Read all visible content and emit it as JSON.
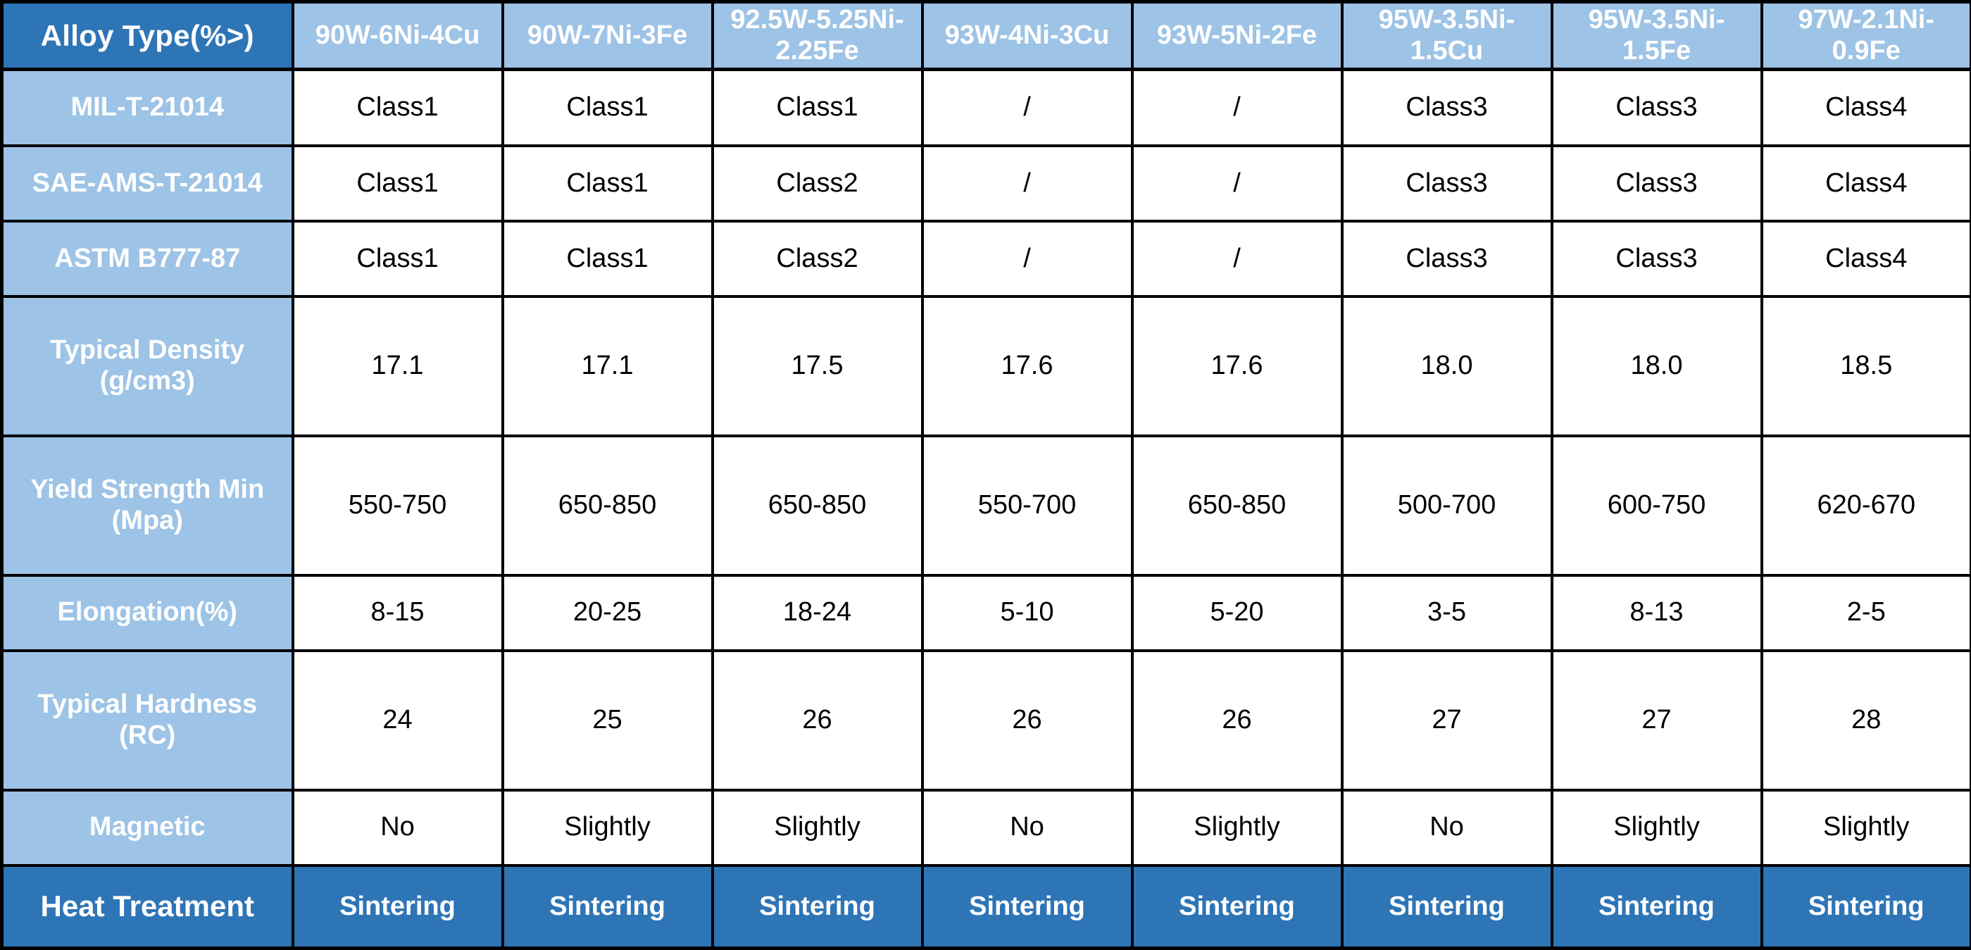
{
  "table": {
    "corner_header": "Alloy Type(%>)",
    "columns": [
      "90W-6Ni-4Cu",
      "90W-7Ni-3Fe",
      "92.5W-5.25Ni-2.25Fe",
      "93W-4Ni-3Cu",
      "93W-5Ni-2Fe",
      "95W-3.5Ni-1.5Cu",
      "95W-3.5Ni-1.5Fe",
      "97W-2.1Ni-0.9Fe"
    ],
    "rows": [
      {
        "label": "MIL-T-21014",
        "style": "normal",
        "values": [
          "Class1",
          "Class1",
          "Class1",
          "/",
          "/",
          "Class3",
          "Class3",
          "Class4"
        ]
      },
      {
        "label": "SAE-AMS-T-21014",
        "style": "normal",
        "values": [
          "Class1",
          "Class1",
          "Class2",
          "/",
          "/",
          "Class3",
          "Class3",
          "Class4"
        ]
      },
      {
        "label": "ASTM B777-87",
        "style": "normal",
        "values": [
          "Class1",
          "Class1",
          "Class2",
          "/",
          "/",
          "Class3",
          "Class3",
          "Class4"
        ]
      },
      {
        "label": "Typical Density (g/cm3)",
        "style": "normal",
        "values": [
          "17.1",
          "17.1",
          "17.5",
          "17.6",
          "17.6",
          "18.0",
          "18.0",
          "18.5"
        ]
      },
      {
        "label": "Yield Strength Min (Mpa)",
        "style": "normal",
        "values": [
          "550-750",
          "650-850",
          "650-850",
          "550-700",
          "650-850",
          "500-700",
          "600-750",
          "620-670"
        ]
      },
      {
        "label": "Elongation(%)",
        "style": "normal",
        "values": [
          "8-15",
          "20-25",
          "18-24",
          "5-10",
          "5-20",
          "3-5",
          "8-13",
          "2-5"
        ]
      },
      {
        "label": "Typical Hardness (RC)",
        "style": "normal",
        "values": [
          "24",
          "25",
          "26",
          "26",
          "26",
          "27",
          "27",
          "28"
        ]
      },
      {
        "label": "Magnetic",
        "style": "normal",
        "values": [
          "No",
          "Slightly",
          "Slightly",
          "No",
          "Slightly",
          "No",
          "Slightly",
          "Slightly"
        ]
      },
      {
        "label": "Heat Treatment",
        "style": "accent",
        "values": [
          "Sintering",
          "Sintering",
          "Sintering",
          "Sintering",
          "Sintering",
          "Sintering",
          "Sintering",
          "Sintering"
        ]
      }
    ]
  },
  "colors": {
    "header_dark_blue": "#2e75b6",
    "header_light_blue": "#9dc3e6",
    "cell_background": "#ffffff",
    "border": "#000000",
    "header_text": "#ffffff",
    "cell_text": "#000000"
  }
}
